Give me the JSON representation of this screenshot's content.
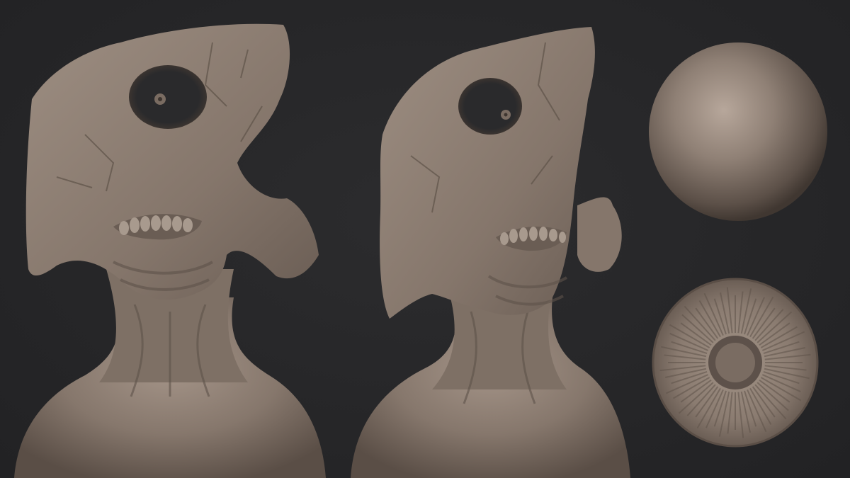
{
  "scene": {
    "description_visible_text": "",
    "background_color": "#28282a",
    "clay_color": "#8a7b70",
    "clay_shadow": "#4e443d",
    "clay_highlight": "#b9aa9e"
  },
  "views": [
    {
      "id": "front",
      "subject": "creature-bust"
    },
    {
      "id": "three-quarter",
      "subject": "creature-bust"
    },
    {
      "id": "sphere",
      "subject": "material-sphere"
    },
    {
      "id": "eye",
      "subject": "eye-iris-disc"
    }
  ]
}
